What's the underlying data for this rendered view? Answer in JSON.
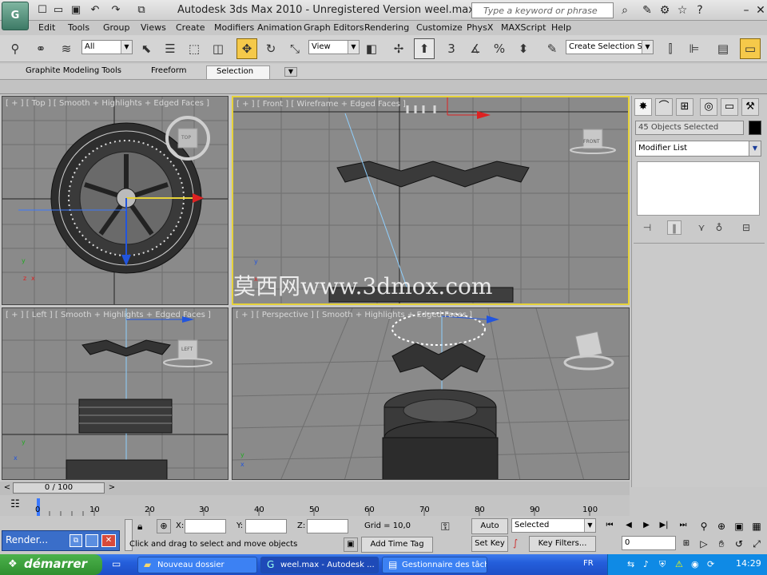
{
  "titlebar": {
    "title": "Autodesk 3ds Max  2010  -  Unregistered Version      weel.max",
    "search_placeholder": "Type a keyword or phrase"
  },
  "menu": [
    "Edit",
    "Tools",
    "Group",
    "Views",
    "Create",
    "Modifiers",
    "Animation",
    "Graph Editors",
    "Rendering",
    "Customize",
    "PhysX",
    "MAXScript",
    "Help"
  ],
  "toolbar": {
    "filter_value": "All",
    "refcoord_value": "View",
    "named_selection_placeholder": "Create Selection Se",
    "snap_label": "3"
  },
  "ribbon": {
    "tabs": [
      "Graphite Modeling Tools",
      "Freeform",
      "Selection"
    ],
    "selected_tab": "Selection"
  },
  "viewports": {
    "top": "[ + ] [ Top ] [ Smooth + Highlights + Edged Faces ]",
    "front": "[ + ] [ Front ] [ Wireframe + Edged Faces ]",
    "left": "[ + ] [ Left ] [ Smooth + Highlights + Edged Faces ]",
    "perspective": "[ + ] [ Perspective ] [ Smooth + Highlights + Edged Faces ]",
    "viewcube": {
      "top": "TOP",
      "front": "FRONT",
      "left": "LEFT"
    }
  },
  "watermark": "莫西网www.3dmox.com",
  "command_panel": {
    "selection_info": "45 Objects Selected",
    "modifier_list": "Modifier List"
  },
  "timeline": {
    "frame_display": "0 / 100",
    "ticks": [
      "0",
      "10",
      "20",
      "30",
      "40",
      "50",
      "60",
      "70",
      "80",
      "90",
      "100"
    ]
  },
  "status": {
    "maxscript_label": "Render...",
    "prompt": "Click and drag to select and move objects",
    "x_label": "X:",
    "y_label": "Y:",
    "z_label": "Z:",
    "grid": "Grid = 10,0",
    "add_time_tag": "Add Time Tag",
    "auto_key": "Auto Key",
    "set_key": "Set Key",
    "key_mode": "Selected",
    "key_filters": "Key Filters...",
    "frame": "0"
  },
  "taskbar": {
    "start": "démarrer",
    "tasks": [
      "Nouveau dossier",
      "weel.max - Autodesk ...",
      "Gestionnaire des tâch..."
    ],
    "lang": "FR",
    "clock": "14:29"
  },
  "colors": {
    "active_viewport_border": "#e6d23a",
    "taskbar": "#245edb",
    "start_button": "#2f8f2f"
  }
}
